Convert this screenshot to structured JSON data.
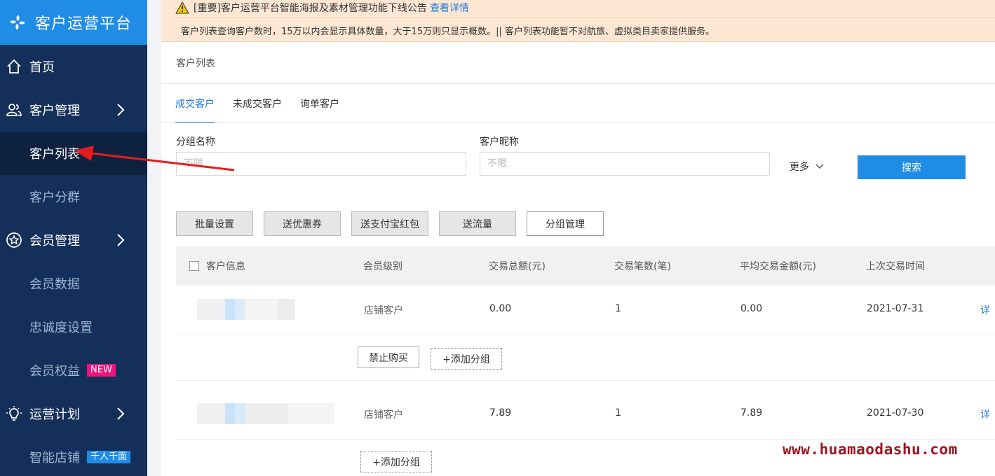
{
  "colors": {
    "sidebar_bg": "#14305a",
    "brand_bg": "#1f8ce6",
    "accent": "#1f7ae0",
    "new_tag": "#f0147a",
    "notice_bg": "#fde7d3",
    "watermark": "#a0141e"
  },
  "brand": {
    "title": "客户运营平台",
    "icon": "pinwheel-logo-icon"
  },
  "sidebar": {
    "home": {
      "label": "首页",
      "icon": "home-icon"
    },
    "customer_mgmt": {
      "label": "客户管理",
      "icon": "users-icon"
    },
    "customer_list": {
      "label": "客户列表"
    },
    "customer_group": {
      "label": "客户分群"
    },
    "member_mgmt": {
      "label": "会员管理",
      "icon": "star-circle-icon"
    },
    "member_data": {
      "label": "会员数据"
    },
    "loyalty": {
      "label": "忠诚度设置"
    },
    "member_rights": {
      "label": "会员权益",
      "tag": "NEW"
    },
    "ops_plan": {
      "label": "运营计划",
      "icon": "lightbulb-icon"
    },
    "smart_store": {
      "label": "智能店铺",
      "tag": "千人千面"
    }
  },
  "notice": {
    "title": "[重要]客户运营平台智能海报及素材管理功能下线公告",
    "link": "查看详情",
    "detail": "客户列表查询客户数时，15万以内会显示具体数量，大于15万则只显示概数。|| 客户列表功能暂不对航旅、虚拟类目卖家提供服务。"
  },
  "page": {
    "title": "客户列表"
  },
  "tabs": [
    "成交客户",
    "未成交客户",
    "询单客户"
  ],
  "filters": {
    "group_name": {
      "label": "分组名称",
      "placeholder": "不限"
    },
    "nickname": {
      "label": "客户昵称",
      "placeholder": "不限"
    },
    "more": "更多",
    "search": "搜索"
  },
  "actions": [
    "批量设置",
    "送优惠券",
    "送支付宝红包",
    "送流量",
    "分组管理"
  ],
  "table": {
    "headers": [
      "客户信息",
      "会员级别",
      "交易总额(元)",
      "交易笔数(笔)",
      "平均交易金额(元)",
      "上次交易时间"
    ],
    "detail": "详",
    "rows": [
      {
        "level": "店铺客户",
        "total": "0.00",
        "count": "1",
        "avg": "0.00",
        "last": "2021-07-31",
        "buttons": [
          "禁止购买",
          "+添加分组"
        ]
      },
      {
        "level": "店铺客户",
        "total": "7.89",
        "count": "1",
        "avg": "7.89",
        "last": "2021-07-30",
        "buttons": [
          "+添加分组"
        ]
      }
    ]
  },
  "watermark": "www.huamaodashu.com"
}
